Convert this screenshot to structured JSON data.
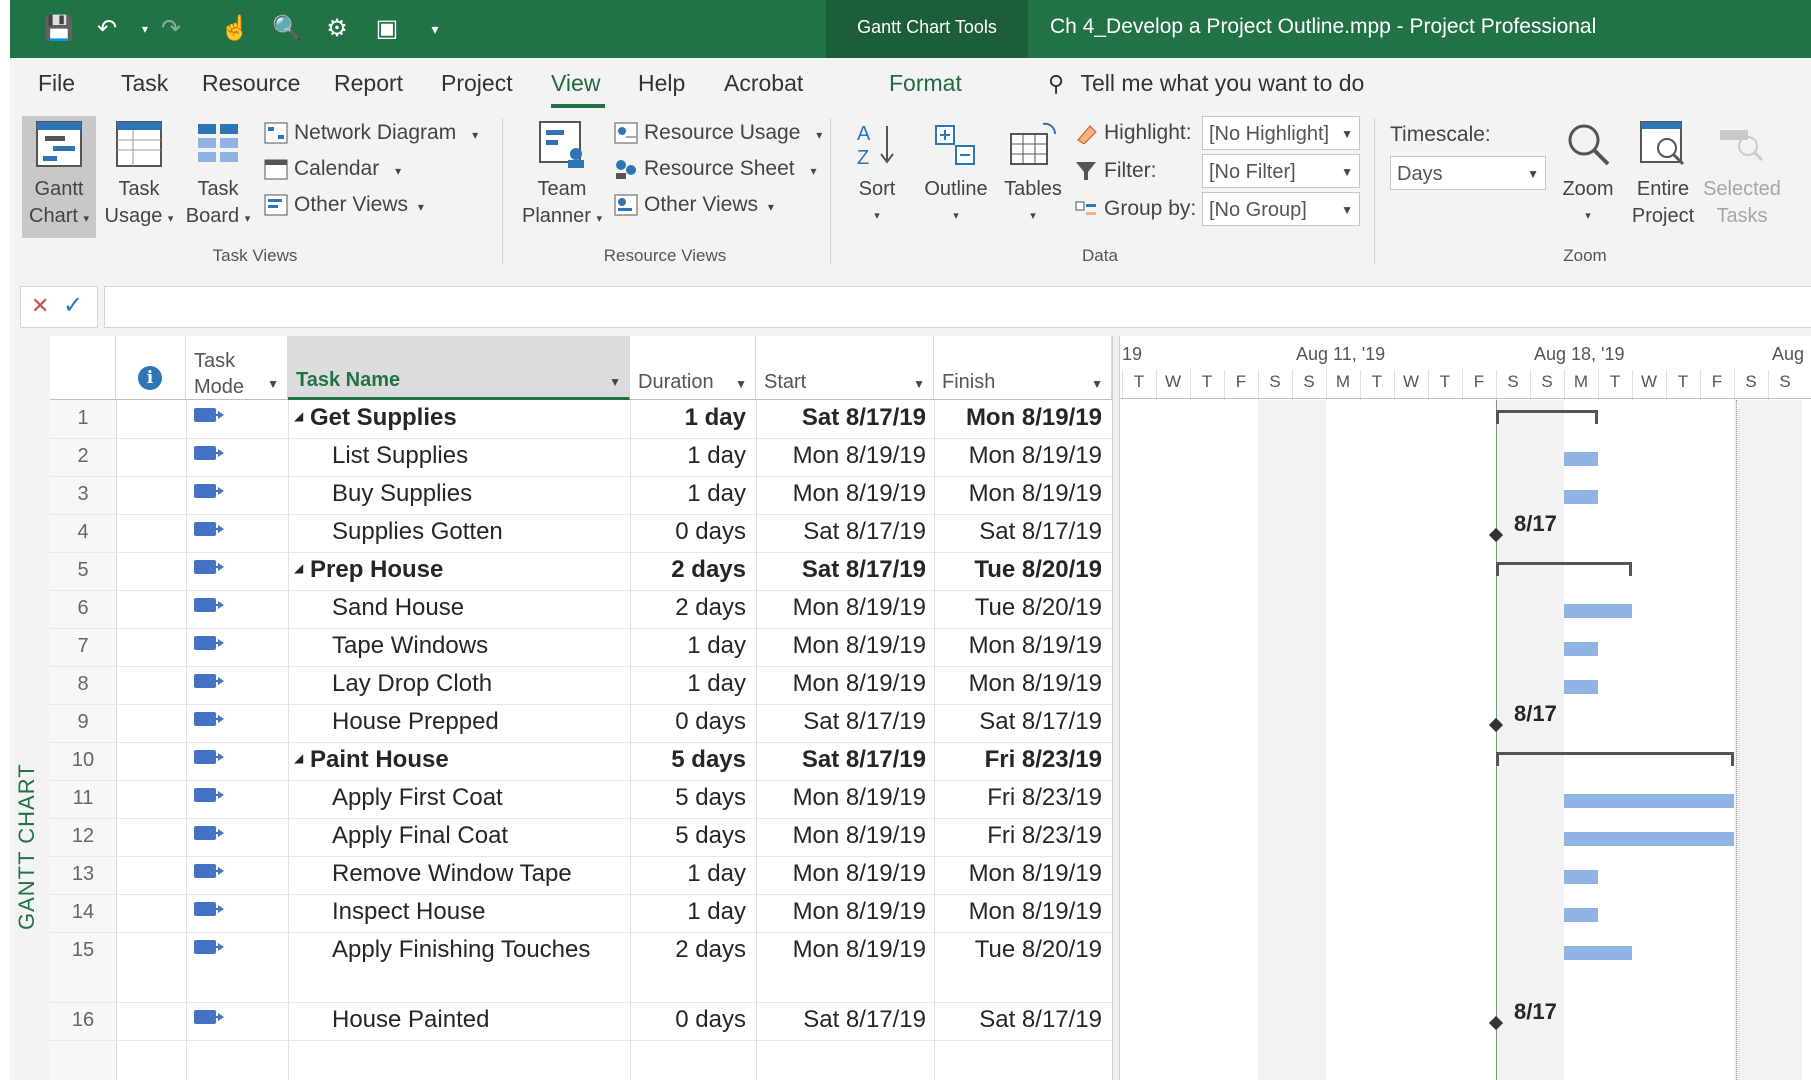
{
  "title_bar": {
    "context_tab": "Gantt Chart Tools",
    "document_title": "Ch 4_Develop a Project Outline.mpp  -  Project Professional"
  },
  "tabs": [
    "File",
    "Task",
    "Resource",
    "Report",
    "Project",
    "View",
    "Help",
    "Acrobat",
    "Format"
  ],
  "active_tab": "View",
  "tell_me": "Tell me what you want to do",
  "ribbon": {
    "task_views": {
      "label": "Task Views",
      "gantt_chart": [
        "Gantt",
        "Chart"
      ],
      "task_usage": [
        "Task",
        "Usage"
      ],
      "task_board": [
        "Task",
        "Board"
      ],
      "network_diagram": "Network Diagram",
      "calendar": "Calendar",
      "other_views": "Other Views"
    },
    "resource_views": {
      "label": "Resource Views",
      "team_planner": [
        "Team",
        "Planner"
      ],
      "resource_usage": "Resource Usage",
      "resource_sheet": "Resource Sheet",
      "other_views": "Other Views"
    },
    "data": {
      "label": "Data",
      "sort": "Sort",
      "outline": "Outline",
      "tables": "Tables",
      "highlight_label": "Highlight:",
      "highlight_value": "[No Highlight]",
      "filter_label": "Filter:",
      "filter_value": "[No Filter]",
      "group_label": "Group by:",
      "group_value": "[No Group]"
    },
    "zoom": {
      "label": "Zoom",
      "timescale_label": "Timescale:",
      "timescale_value": "Days",
      "zoom": "Zoom",
      "entire_project": [
        "Entire",
        "Project"
      ],
      "selected_tasks": [
        "Selected",
        "Tasks"
      ]
    }
  },
  "entry_bar": {
    "cancel": "✕",
    "accept": "✓"
  },
  "side_label": "GANTT CHART",
  "columns": {
    "info": "i",
    "task_mode": [
      "Task",
      "Mode"
    ],
    "task_name": "Task Name",
    "duration": "Duration",
    "start": "Start",
    "finish": "Finish"
  },
  "tasks": [
    {
      "id": "1",
      "name": "Get Supplies",
      "duration": "1 day",
      "start": "Sat 8/17/19",
      "finish": "Mon 8/19/19",
      "summary": true
    },
    {
      "id": "2",
      "name": "List Supplies",
      "duration": "1 day",
      "start": "Mon 8/19/19",
      "finish": "Mon 8/19/19"
    },
    {
      "id": "3",
      "name": "Buy Supplies",
      "duration": "1 day",
      "start": "Mon 8/19/19",
      "finish": "Mon 8/19/19"
    },
    {
      "id": "4",
      "name": "Supplies Gotten",
      "duration": "0 days",
      "start": "Sat 8/17/19",
      "finish": "Sat 8/17/19",
      "milestone": "8/17"
    },
    {
      "id": "5",
      "name": "Prep House",
      "duration": "2 days",
      "start": "Sat 8/17/19",
      "finish": "Tue 8/20/19",
      "summary": true
    },
    {
      "id": "6",
      "name": "Sand House",
      "duration": "2 days",
      "start": "Mon 8/19/19",
      "finish": "Tue 8/20/19"
    },
    {
      "id": "7",
      "name": "Tape Windows",
      "duration": "1 day",
      "start": "Mon 8/19/19",
      "finish": "Mon 8/19/19"
    },
    {
      "id": "8",
      "name": "Lay Drop Cloth",
      "duration": "1 day",
      "start": "Mon 8/19/19",
      "finish": "Mon 8/19/19"
    },
    {
      "id": "9",
      "name": "House Prepped",
      "duration": "0 days",
      "start": "Sat 8/17/19",
      "finish": "Sat 8/17/19",
      "milestone": "8/17"
    },
    {
      "id": "10",
      "name": "Paint House",
      "duration": "5 days",
      "start": "Sat 8/17/19",
      "finish": "Fri 8/23/19",
      "summary": true
    },
    {
      "id": "11",
      "name": "Apply First Coat",
      "duration": "5 days",
      "start": "Mon 8/19/19",
      "finish": "Fri 8/23/19"
    },
    {
      "id": "12",
      "name": "Apply Final Coat",
      "duration": "5 days",
      "start": "Mon 8/19/19",
      "finish": "Fri 8/23/19"
    },
    {
      "id": "13",
      "name": "Remove Window Tape",
      "duration": "1 day",
      "start": "Mon 8/19/19",
      "finish": "Mon 8/19/19"
    },
    {
      "id": "14",
      "name": "Inspect House",
      "duration": "1 day",
      "start": "Mon 8/19/19",
      "finish": "Mon 8/19/19"
    },
    {
      "id": "15",
      "name": "Apply Finishing Touches",
      "duration": "2 days",
      "start": "Mon 8/19/19",
      "finish": "Tue 8/20/19"
    },
    {
      "id": "16",
      "name": "House Painted",
      "duration": "0 days",
      "start": "Sat 8/17/19",
      "finish": "Sat 8/17/19",
      "milestone": "8/17"
    }
  ],
  "timescale": {
    "weeks": [
      "19",
      "Aug 11, '19",
      "Aug 18, '19",
      "Aug"
    ],
    "days": [
      "T",
      "W",
      "T",
      "F",
      "S",
      "S",
      "M",
      "T",
      "W",
      "T",
      "F",
      "S",
      "S",
      "M",
      "T",
      "W",
      "T",
      "F",
      "S",
      "S"
    ]
  },
  "colors": {
    "brand": "#217346",
    "task_bar": "#8fb4e3",
    "summary_bar": "#555555",
    "mode_icon": "#4472c4"
  }
}
